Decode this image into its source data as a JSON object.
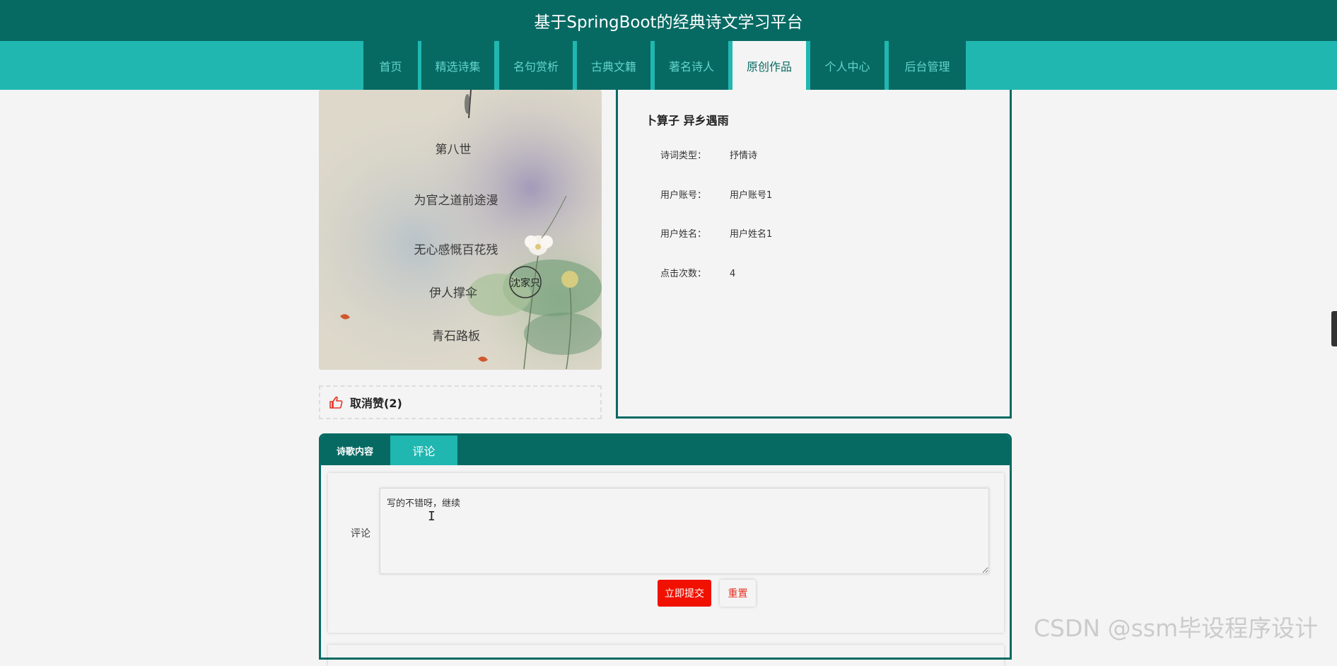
{
  "site": {
    "title": "基于SpringBoot的经典诗文学习平台"
  },
  "nav": {
    "items": [
      {
        "label": "首页"
      },
      {
        "label": "精选诗集"
      },
      {
        "label": "名句赏析"
      },
      {
        "label": "古典文籍"
      },
      {
        "label": "著名诗人"
      },
      {
        "label": "原创作品",
        "active": true
      },
      {
        "label": "个人中心"
      },
      {
        "label": "后台管理"
      }
    ]
  },
  "image": {
    "icon": "poem-illustration",
    "lines": [
      "第八世",
      "为官之道前途漫",
      "无心感慨百花残",
      "伊人撑伞",
      "青石路板"
    ],
    "seal": "沈家只"
  },
  "like": {
    "icon": "thumbs-up-icon",
    "label": "取消赞(2)"
  },
  "detail": {
    "title": "卜算子 异乡遇雨",
    "fields": [
      {
        "key": "诗词类型：",
        "value": "抒情诗"
      },
      {
        "key": "用户账号：",
        "value": "用户账号1"
      },
      {
        "key": "用户姓名：",
        "value": "用户姓名1"
      },
      {
        "key": "点击次数：",
        "value": "4"
      }
    ]
  },
  "tabs": [
    {
      "label": "诗歌内容"
    },
    {
      "label": "评论",
      "active": true
    }
  ],
  "comment": {
    "label": "评论",
    "value": "写的不错呀，继续",
    "submit_label": "立即提交",
    "reset_label": "重置"
  },
  "watermark": "CSDN @ssm毕设程序设计",
  "colors": {
    "primary": "#066a63",
    "accent": "#20b7b0",
    "danger": "#f01100"
  }
}
